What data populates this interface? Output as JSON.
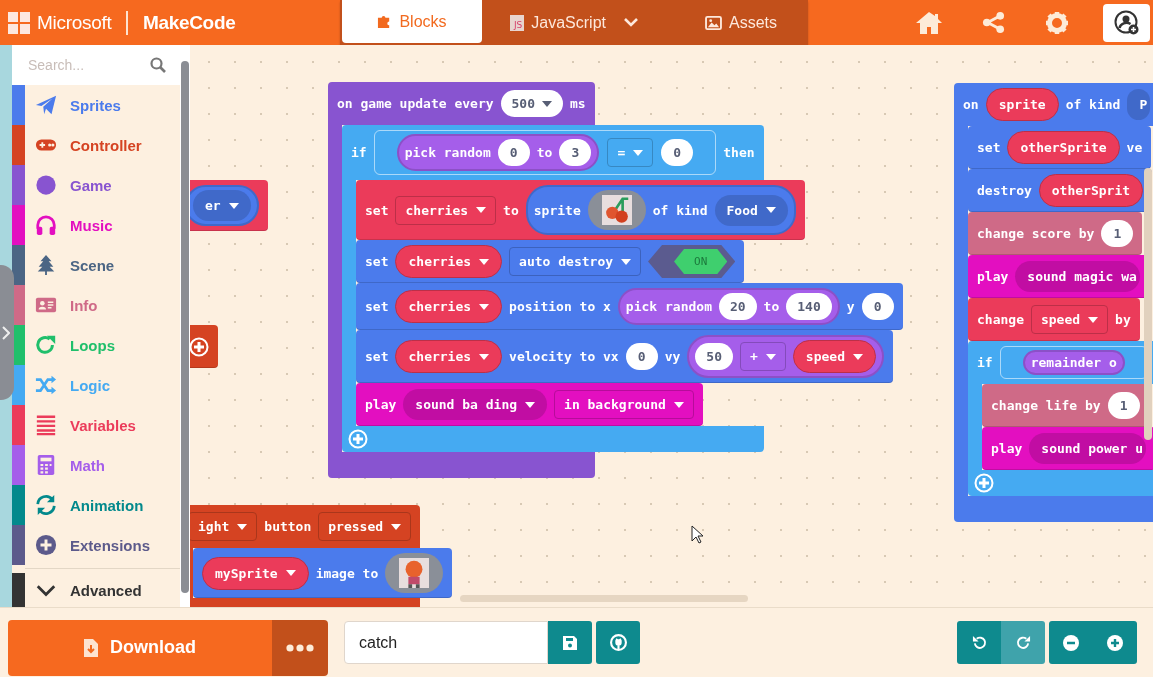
{
  "header": {
    "brand": "Microsoft",
    "product": "MakeCode",
    "tabs": [
      {
        "label": "Blocks",
        "selected": true
      },
      {
        "label": "JavaScript",
        "badge": "JS",
        "selected": false
      },
      {
        "label": "Assets",
        "selected": false
      }
    ]
  },
  "toolbox": {
    "search": {
      "placeholder": "Search..."
    },
    "categories": [
      {
        "label": "Sprites",
        "color": "#4b7bec"
      },
      {
        "label": "Controller",
        "color": "#d54322"
      },
      {
        "label": "Game",
        "color": "#8854d0"
      },
      {
        "label": "Music",
        "color": "#e30fc0"
      },
      {
        "label": "Scene",
        "color": "#4b6584"
      },
      {
        "label": "Info",
        "color": "#cf6a87"
      },
      {
        "label": "Loops",
        "color": "#20bf6b"
      },
      {
        "label": "Logic",
        "color": "#45aaf2"
      },
      {
        "label": "Variables",
        "color": "#eb3b5a"
      },
      {
        "label": "Math",
        "color": "#a55eea"
      },
      {
        "label": "Animation",
        "color": "#03898c"
      },
      {
        "label": "Extensions",
        "color": "#5c5a8b"
      }
    ],
    "advanced": {
      "label": "Advanced",
      "expanded": false
    }
  },
  "workspace": {
    "stacks": [
      {
        "color": "#8854d0",
        "parts": [
          {
            "kind": "label",
            "text": "on game update every"
          },
          {
            "kind": "number",
            "text": "500",
            "dropdown": true
          },
          {
            "kind": "label",
            "text": "ms"
          }
        ],
        "children": [
          {
            "color": "#45aaf2",
            "add_button": true,
            "parts": [
              {
                "kind": "label",
                "text": "if"
              },
              {
                "kind": "boolean",
                "parts": [
                  {
                    "kind": "reporter",
                    "color": "#a55eea",
                    "parts": [
                      {
                        "kind": "label",
                        "text": "pick random"
                      },
                      {
                        "kind": "number",
                        "text": "0",
                        "dropdown": false
                      },
                      {
                        "kind": "label",
                        "text": "to"
                      },
                      {
                        "kind": "number",
                        "text": "3",
                        "dropdown": false
                      }
                    ]
                  },
                  {
                    "kind": "dropdown",
                    "text": "=",
                    "dropdown": true
                  },
                  {
                    "kind": "number",
                    "text": "0",
                    "dropdown": false
                  }
                ]
              },
              {
                "kind": "label",
                "text": "then"
              }
            ],
            "children": [
              {
                "color": "#eb3b5a",
                "parts": [
                  {
                    "kind": "label",
                    "text": "set"
                  },
                  {
                    "kind": "dropdown",
                    "text": "cherries",
                    "dropdown": true
                  },
                  {
                    "kind": "label",
                    "text": "to"
                  },
                  {
                    "kind": "reporter",
                    "color": "#4b7bec",
                    "parts": [
                      {
                        "kind": "label",
                        "text": "sprite"
                      },
                      {
                        "kind": "image"
                      },
                      {
                        "kind": "label",
                        "text": "of kind"
                      },
                      {
                        "kind": "menu",
                        "text": "Food",
                        "dropdown": true
                      }
                    ]
                  }
                ]
              },
              {
                "color": "#4b7bec",
                "parts": [
                  {
                    "kind": "label",
                    "text": "set"
                  },
                  {
                    "kind": "variable",
                    "text": "cherries",
                    "dropdown": true
                  },
                  {
                    "kind": "dropdown",
                    "text": "auto destroy",
                    "dropdown": true
                  },
                  {
                    "kind": "toggle",
                    "text": "ON",
                    "on": true
                  }
                ]
              },
              {
                "color": "#4b7bec",
                "parts": [
                  {
                    "kind": "label",
                    "text": "set"
                  },
                  {
                    "kind": "variable",
                    "text": "cherries",
                    "dropdown": true
                  },
                  {
                    "kind": "label",
                    "text": "position to x"
                  },
                  {
                    "kind": "reporter",
                    "color": "#a55eea",
                    "parts": [
                      {
                        "kind": "label",
                        "text": "pick random"
                      },
                      {
                        "kind": "number",
                        "text": "20",
                        "dropdown": false
                      },
                      {
                        "kind": "label",
                        "text": "to"
                      },
                      {
                        "kind": "number",
                        "text": "140",
                        "dropdown": false
                      }
                    ]
                  },
                  {
                    "kind": "label",
                    "text": "y"
                  },
                  {
                    "kind": "number",
                    "text": "0",
                    "dropdown": false
                  }
                ]
              },
              {
                "color": "#4b7bec",
                "parts": [
                  {
                    "kind": "label",
                    "text": "set"
                  },
                  {
                    "kind": "variable",
                    "text": "cherries",
                    "dropdown": true
                  },
                  {
                    "kind": "label",
                    "text": "velocity to vx"
                  },
                  {
                    "kind": "number",
                    "text": "0",
                    "dropdown": false
                  },
                  {
                    "kind": "label",
                    "text": "vy"
                  },
                  {
                    "kind": "reporter",
                    "color": "#a55eea",
                    "parts": [
                      {
                        "kind": "number",
                        "text": "50",
                        "dropdown": false
                      },
                      {
                        "kind": "dropdown",
                        "text": "+",
                        "dropdown": true
                      },
                      {
                        "kind": "variable",
                        "text": "speed",
                        "dropdown": true
                      }
                    ]
                  }
                ]
              },
              {
                "color": "#e30fc0",
                "parts": [
                  {
                    "kind": "label",
                    "text": "play"
                  },
                  {
                    "kind": "menu",
                    "text": "sound ba ding",
                    "dropdown": true
                  },
                  {
                    "kind": "dropdown",
                    "text": "in background",
                    "dropdown": true
                  }
                ]
              }
            ]
          }
        ]
      },
      {
        "color": "#4b7bec",
        "parts": [
          {
            "kind": "label",
            "text": "on"
          },
          {
            "kind": "variable",
            "text": "sprite",
            "dropdown": false
          },
          {
            "kind": "label",
            "text": "of kind"
          },
          {
            "kind": "menu",
            "text": "P",
            "dropdown": false
          }
        ],
        "children": [
          {
            "color": "#4b7bec",
            "parts": [
              {
                "kind": "label",
                "text": "set"
              },
              {
                "kind": "variable",
                "text": "otherSprite",
                "dropdown": false
              },
              {
                "kind": "label",
                "text": "ve"
              }
            ]
          },
          {
            "color": "#4b7bec",
            "parts": [
              {
                "kind": "label",
                "text": "destroy"
              },
              {
                "kind": "variable",
                "text": "otherSprit",
                "dropdown": false
              }
            ]
          },
          {
            "color": "#cf6a87",
            "parts": [
              {
                "kind": "label",
                "text": "change score by"
              },
              {
                "kind": "number",
                "text": "1",
                "dropdown": false
              }
            ]
          },
          {
            "color": "#e30fc0",
            "parts": [
              {
                "kind": "label",
                "text": "play"
              },
              {
                "kind": "menu",
                "text": "sound magic wa",
                "dropdown": false
              }
            ]
          },
          {
            "color": "#eb3b5a",
            "parts": [
              {
                "kind": "label",
                "text": "change"
              },
              {
                "kind": "dropdown",
                "text": "speed",
                "dropdown": true
              },
              {
                "kind": "label",
                "text": "by"
              }
            ]
          },
          {
            "color": "#45aaf2",
            "add_button": true,
            "parts": [
              {
                "kind": "label",
                "text": "if"
              },
              {
                "kind": "boolean",
                "parts": [
                  {
                    "kind": "reporter",
                    "color": "#a55eea",
                    "parts": [
                      {
                        "kind": "label",
                        "text": "remainder o"
                      }
                    ]
                  }
                ]
              }
            ],
            "children": [
              {
                "color": "#cf6a87",
                "parts": [
                  {
                    "kind": "label",
                    "text": "change life by"
                  },
                  {
                    "kind": "number",
                    "text": "1",
                    "dropdown": false
                  }
                ]
              },
              {
                "color": "#e30fc0",
                "parts": [
                  {
                    "kind": "label",
                    "text": "play"
                  },
                  {
                    "kind": "menu",
                    "text": "sound power u",
                    "dropdown": false
                  }
                ]
              }
            ]
          }
        ]
      },
      {
        "color": "#eb3b5a",
        "parts": [
          {
            "kind": "reporter",
            "color": "#4b7bec",
            "parts": [
              {
                "kind": "menu",
                "text": "er",
                "dropdown": true
              }
            ]
          }
        ]
      },
      {
        "color": "#d54322",
        "parts": [
          {
            "kind": "plus"
          }
        ]
      },
      {
        "color": "#d54322",
        "parts": [
          {
            "kind": "dropdown",
            "text": "ight",
            "dropdown": true
          },
          {
            "kind": "label",
            "text": "button"
          },
          {
            "kind": "dropdown",
            "text": "pressed",
            "dropdown": true
          }
        ],
        "children": [
          {
            "color": "#4b7bec",
            "parts": [
              {
                "kind": "variable",
                "text": "mySprite",
                "dropdown": true
              },
              {
                "kind": "label",
                "text": "image to"
              },
              {
                "kind": "image"
              }
            ]
          }
        ]
      }
    ]
  },
  "footer": {
    "download": "Download",
    "project_name": "catch",
    "undo": {
      "disabled": false
    },
    "redo": {
      "disabled": true
    }
  }
}
